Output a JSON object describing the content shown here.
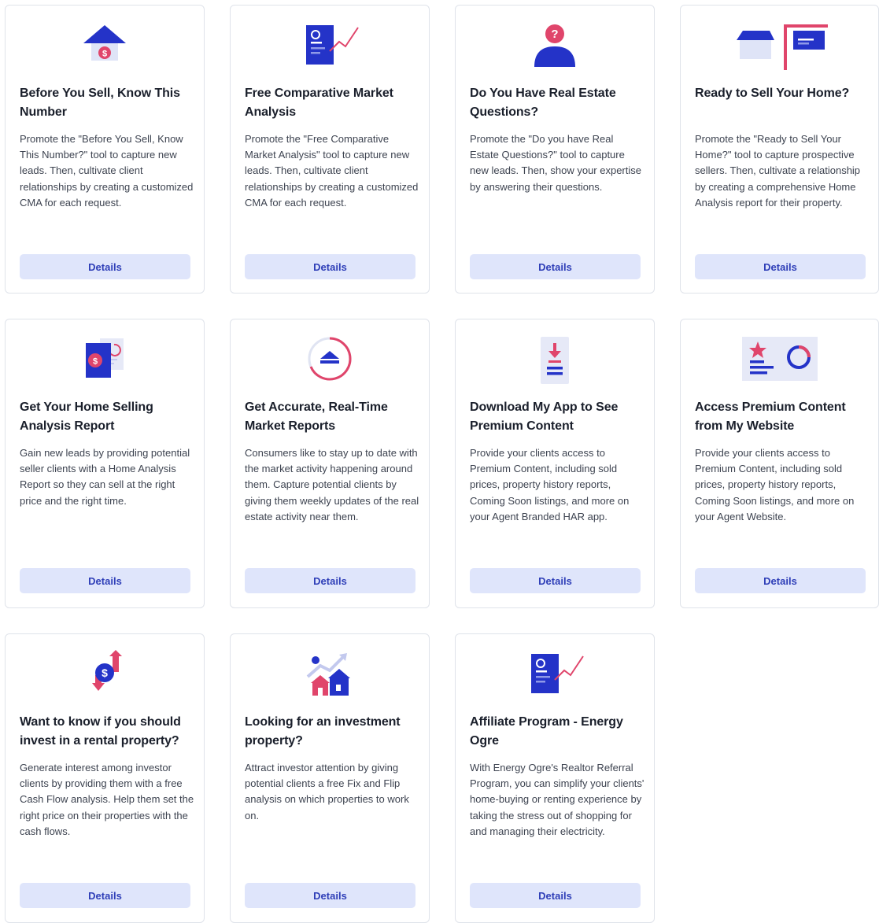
{
  "colors": {
    "accent_blue": "#2433c8",
    "accent_pink": "#e0456b",
    "button_bg": "#dfe5fb",
    "button_text": "#2f3fb8"
  },
  "cards": [
    {
      "icon": "house-dollar-icon",
      "title": "Before You Sell, Know This Number",
      "description": "Promote the \"Before You Sell, Know This Number?\" tool to capture new leads. Then, cultivate client relationships by creating a customized CMA for each request.",
      "button": "Details"
    },
    {
      "icon": "report-chart-icon",
      "title": "Free Comparative Market Analysis",
      "description": "Promote the \"Free Comparative Market Analysis\" tool to capture new leads. Then, cultivate client relationships by creating a customized CMA for each request.",
      "button": "Details"
    },
    {
      "icon": "person-question-icon",
      "title": "Do You Have Real Estate Questions?",
      "description": "Promote the \"Do you have Real Estate Questions?\" tool to capture new leads. Then, show your expertise by answering their questions.",
      "button": "Details"
    },
    {
      "icon": "house-for-sale-sign-icon",
      "title": "Ready to Sell Your Home?",
      "description": "Promote the \"Ready to Sell Your Home?\" tool to capture prospective sellers. Then, cultivate a relationship by creating a comprehensive Home Analysis report for their property.",
      "button": "Details"
    },
    {
      "icon": "analysis-report-icon",
      "title": "Get Your Home Selling Analysis Report",
      "description": "Gain new leads by providing potential seller clients with a Home Analysis Report so they can sell at the right price and the right time.",
      "button": "Details"
    },
    {
      "icon": "market-gauge-icon",
      "title": "Get Accurate, Real-Time Market Reports",
      "description": "Consumers like to stay up to date with the market activity happening around them. Capture potential clients by giving them weekly updates of the real estate activity near them.",
      "button": "Details"
    },
    {
      "icon": "phone-download-icon",
      "title": "Download My App to See Premium Content",
      "description": "Provide your clients access to Premium Content, including sold prices, property history reports, Coming Soon listings, and more on your Agent Branded HAR app.",
      "button": "Details"
    },
    {
      "icon": "premium-content-icon",
      "title": "Access Premium Content from My Website",
      "description": "Provide your clients access to Premium Content, including sold prices, property history reports, Coming Soon listings, and more on your Agent Website.",
      "button": "Details"
    },
    {
      "icon": "cash-flow-icon",
      "title": "Want to know if you should invest in a rental property?",
      "description": "Generate interest among investor clients by providing them with a free Cash Flow analysis. Help them set the right price on their properties with the cash flows.",
      "button": "Details"
    },
    {
      "icon": "investment-houses-icon",
      "title": "Looking for an investment property?",
      "description": "Attract investor attention by giving potential clients a free Fix and Flip analysis on which properties to work on.",
      "button": "Details"
    },
    {
      "icon": "report-chart-icon",
      "title": "Affiliate Program - Energy Ogre",
      "description": "With Energy Ogre's Realtor Referral Program, you can simplify your clients' home-buying or renting experience by taking the stress out of shopping for and managing their electricity.",
      "button": "Details"
    }
  ]
}
